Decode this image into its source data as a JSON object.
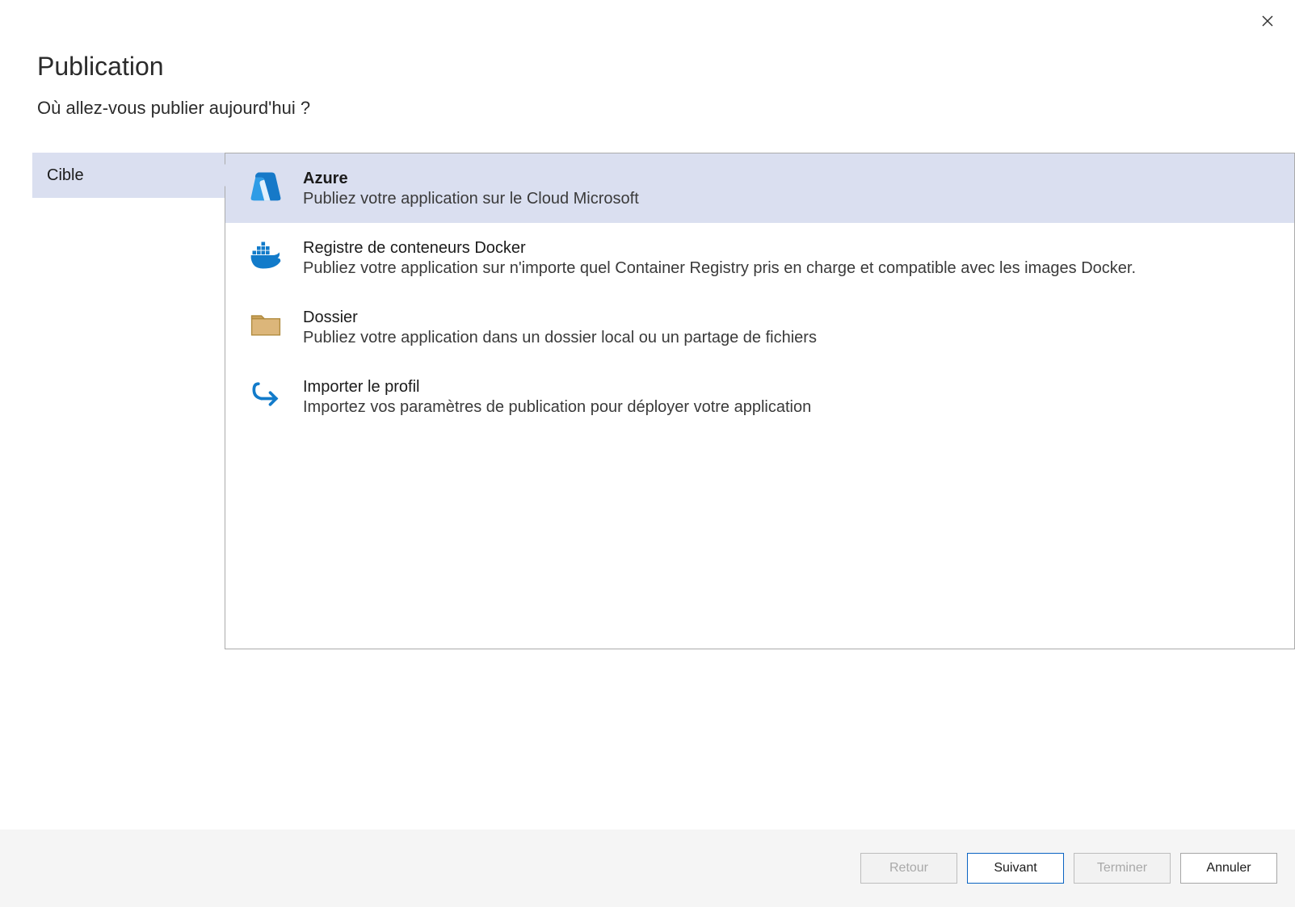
{
  "header": {
    "title": "Publication",
    "subtitle": "Où allez-vous publier aujourd'hui ?"
  },
  "sidebar": {
    "items": [
      {
        "label": "Cible",
        "selected": true
      }
    ]
  },
  "options": [
    {
      "title": "Azure",
      "desc": "Publiez votre application sur le Cloud Microsoft",
      "icon": "azure",
      "selected": true
    },
    {
      "title": "Registre de conteneurs Docker",
      "desc": "Publiez votre application sur n'importe quel Container Registry pris en charge et compatible avec les images Docker.",
      "icon": "docker",
      "selected": false
    },
    {
      "title": "Dossier",
      "desc": "Publiez votre application dans un dossier local ou un partage de fichiers",
      "icon": "folder",
      "selected": false
    },
    {
      "title": "Importer le profil",
      "desc": "Importez vos paramètres de publication pour déployer votre application",
      "icon": "import",
      "selected": false
    }
  ],
  "footer": {
    "back": "Retour",
    "next": "Suivant",
    "finish": "Terminer",
    "cancel": "Annuler"
  }
}
